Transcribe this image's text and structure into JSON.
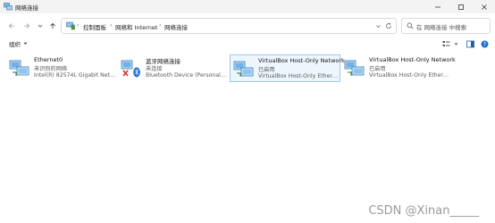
{
  "window": {
    "title": "网络连接"
  },
  "address": {
    "crumbs": [
      "控制面板",
      "网络和 Internet",
      "网络连接"
    ]
  },
  "search": {
    "placeholder": "在 网络连接 中搜索"
  },
  "toolbar": {
    "organize_label": "组织"
  },
  "connections": [
    {
      "name": "Ethernet0",
      "status": "未识别的网络",
      "device": "Intel(R) 82574L Gigabit Network...",
      "type": "ethernet",
      "selected": false
    },
    {
      "name": "蓝牙网络连接",
      "status": "未连接",
      "device": "Bluetooth Device (Personal Area ...",
      "type": "bluetooth",
      "selected": false
    },
    {
      "name": "VirtualBox Host-Only Network",
      "status": "已启用",
      "device": "VirtualBox Host-Only Ethernet Ad...",
      "type": "ethernet",
      "selected": true
    },
    {
      "name": "VirtualBox Host-Only Network",
      "status": "已启用",
      "device": "VirtualBox Host-Only Ethernet Ad...",
      "type": "ethernet",
      "selected": false
    }
  ],
  "watermark": "CSDN @Xinan_____",
  "icons": {
    "app": "network-connections-icon",
    "back": "arrow-left-icon",
    "forward": "arrow-right-icon",
    "recent": "chevron-down-icon",
    "up": "arrow-up-icon",
    "refresh": "refresh-icon",
    "search": "search-icon"
  },
  "colors": {
    "accent": "#0067c0",
    "selection_bg": "#eef6fd",
    "selection_border": "#99c9ef"
  }
}
